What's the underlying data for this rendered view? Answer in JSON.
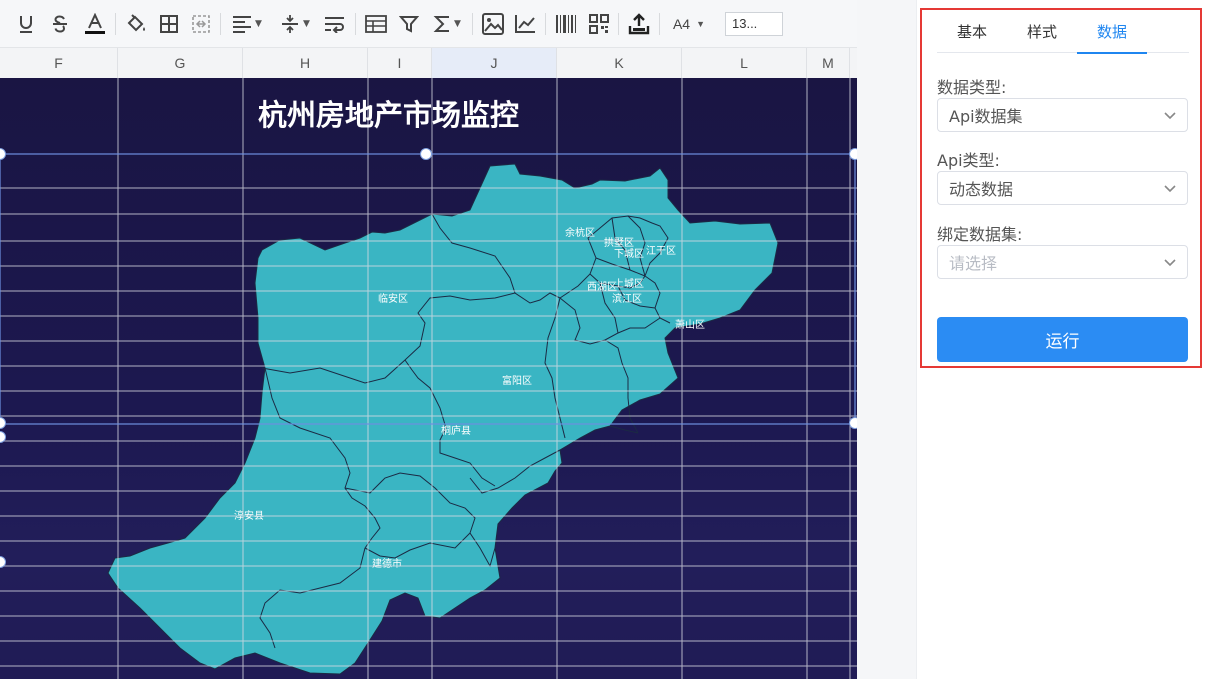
{
  "toolbar": {
    "paper_size": "A4",
    "font_size": "13...",
    "icons": [
      "underline-icon",
      "strikethrough-icon",
      "font-color-icon",
      "fill-color-icon",
      "border-icon",
      "merge-cells-icon",
      "align-icon",
      "vertical-align-icon",
      "wrap-text-icon",
      "table-icon",
      "filter-icon",
      "sum-icon",
      "image-icon",
      "chart-icon",
      "barcode-icon",
      "qrcode-icon",
      "upload-icon"
    ]
  },
  "columns": [
    "F",
    "G",
    "H",
    "I",
    "J",
    "K",
    "L",
    "M"
  ],
  "report": {
    "title": "杭州房地产市场监控"
  },
  "map": {
    "fill_color": "#3ab5c3",
    "districts": [
      "余杭区",
      "拱墅区",
      "下城区",
      "江干区",
      "西湖区",
      "上城区",
      "滨江区",
      "萧山区",
      "临安区",
      "富阳区",
      "桐庐县",
      "淳安县",
      "建德市"
    ]
  },
  "panel": {
    "tabs": [
      "基本",
      "样式",
      "数据"
    ],
    "active_tab": "数据",
    "data_type_label": "数据类型:",
    "data_type_value": "Api数据集",
    "api_type_label": "Api类型:",
    "api_type_value": "动态数据",
    "dataset_label": "绑定数据集:",
    "dataset_placeholder": "请选择",
    "run_button": "运行"
  },
  "colors": {
    "accent": "#2b8cf3",
    "highlight_border": "#e53935",
    "canvas_bg": "#1b1645"
  }
}
